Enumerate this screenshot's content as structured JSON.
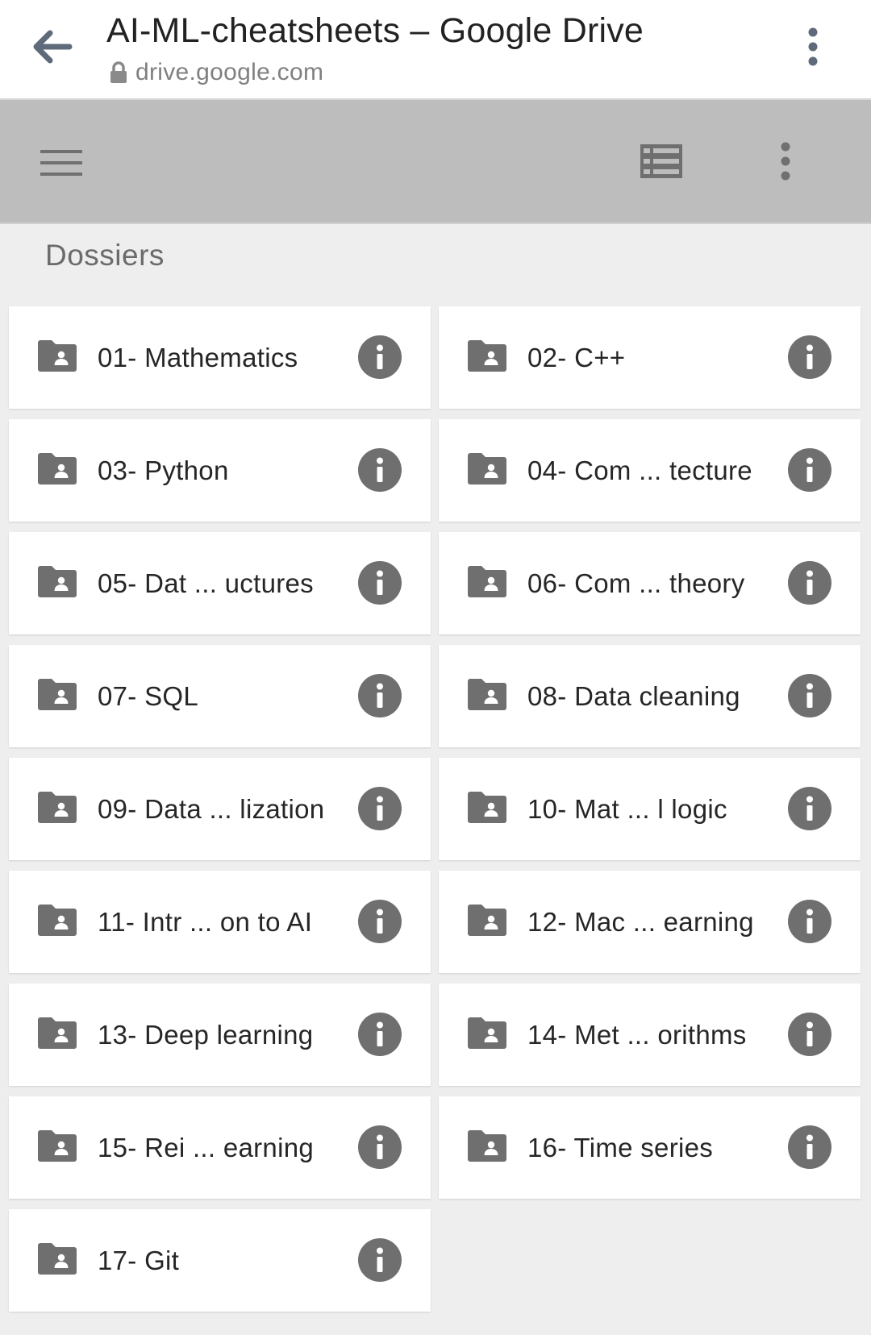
{
  "browser": {
    "title": "AI-ML-cheatsheets – Google Drive",
    "url": "drive.google.com",
    "icons": {
      "back": "arrow-left-icon",
      "lock": "lock-icon",
      "menu": "more-vert-icon"
    }
  },
  "toolbar": {
    "icons": {
      "menu": "hamburger-menu-icon",
      "view": "list-view-icon",
      "more": "more-vert-icon"
    },
    "background_color": "#bdbdbd"
  },
  "section": {
    "title": "Dossiers"
  },
  "folders": [
    {
      "name": "01- Mathematics"
    },
    {
      "name": "02- C++"
    },
    {
      "name": "03- Python"
    },
    {
      "name": "04- Com ... tecture"
    },
    {
      "name": "05- Dat ... uctures"
    },
    {
      "name": "06- Com ... theory"
    },
    {
      "name": "07- SQL"
    },
    {
      "name": "08- Data cleaning"
    },
    {
      "name": "09- Data ... lization"
    },
    {
      "name": "10- Mat ... l logic"
    },
    {
      "name": "11- Intr ... on to AI"
    },
    {
      "name": "12- Mac ... earning"
    },
    {
      "name": "13- Deep learning"
    },
    {
      "name": "14- Met ... orithms"
    },
    {
      "name": "15- Rei ... earning"
    },
    {
      "name": "16- Time series"
    },
    {
      "name": "17- Git"
    }
  ],
  "colors": {
    "icon_gray": "#6f6f6f",
    "card_bg": "#ffffff",
    "page_bg": "#eeeeee"
  }
}
